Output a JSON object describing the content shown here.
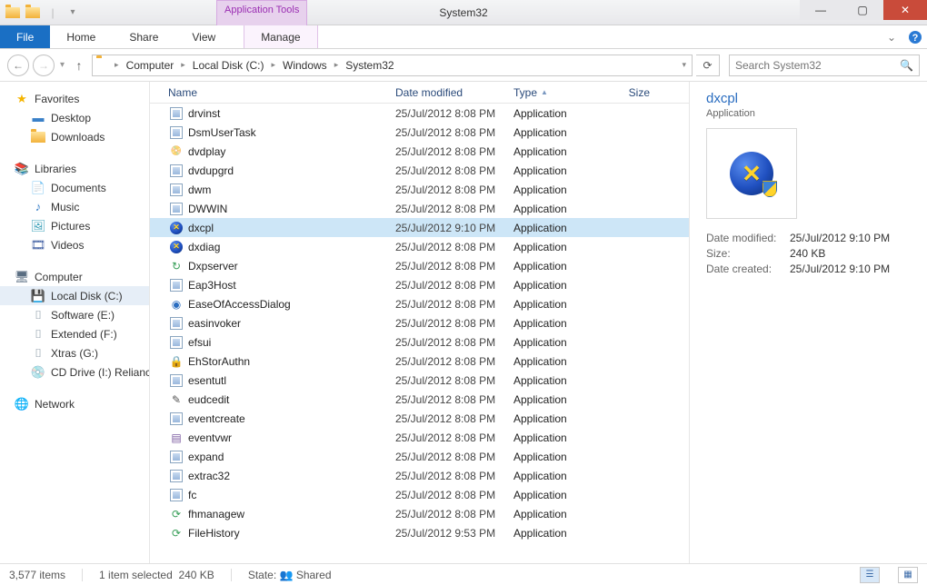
{
  "window": {
    "title": "System32",
    "context_tab": "Application Tools"
  },
  "ribbon": {
    "file": "File",
    "tabs": [
      "Home",
      "Share",
      "View"
    ],
    "context": "Manage"
  },
  "breadcrumb": [
    "Computer",
    "Local Disk (C:)",
    "Windows",
    "System32"
  ],
  "search_placeholder": "Search System32",
  "tree": {
    "favorites": {
      "label": "Favorites",
      "items": [
        "Desktop",
        "Downloads"
      ]
    },
    "libraries": {
      "label": "Libraries",
      "items": [
        "Documents",
        "Music",
        "Pictures",
        "Videos"
      ]
    },
    "computer": {
      "label": "Computer",
      "items": [
        "Local Disk (C:)",
        "Software (E:)",
        "Extended (F:)",
        "Xtras (G:)",
        "CD Drive (I:) Reliance"
      ]
    },
    "network": {
      "label": "Network"
    }
  },
  "columns": {
    "name": "Name",
    "date": "Date modified",
    "type": "Type",
    "size": "Size"
  },
  "files": [
    {
      "name": "drvinst",
      "date": "25/Jul/2012 8:08 PM",
      "type": "Application",
      "icon": "exe"
    },
    {
      "name": "DsmUserTask",
      "date": "25/Jul/2012 8:08 PM",
      "type": "Application",
      "icon": "exe"
    },
    {
      "name": "dvdplay",
      "date": "25/Jul/2012 8:08 PM",
      "type": "Application",
      "icon": "dvd"
    },
    {
      "name": "dvdupgrd",
      "date": "25/Jul/2012 8:08 PM",
      "type": "Application",
      "icon": "exe"
    },
    {
      "name": "dwm",
      "date": "25/Jul/2012 8:08 PM",
      "type": "Application",
      "icon": "exe"
    },
    {
      "name": "DWWIN",
      "date": "25/Jul/2012 8:08 PM",
      "type": "Application",
      "icon": "exe"
    },
    {
      "name": "dxcpl",
      "date": "25/Jul/2012 9:10 PM",
      "type": "Application",
      "icon": "dx",
      "selected": true
    },
    {
      "name": "dxdiag",
      "date": "25/Jul/2012 8:08 PM",
      "type": "Application",
      "icon": "dx"
    },
    {
      "name": "Dxpserver",
      "date": "25/Jul/2012 8:08 PM",
      "type": "Application",
      "icon": "grn"
    },
    {
      "name": "Eap3Host",
      "date": "25/Jul/2012 8:08 PM",
      "type": "Application",
      "icon": "exe"
    },
    {
      "name": "EaseOfAccessDialog",
      "date": "25/Jul/2012 8:08 PM",
      "type": "Application",
      "icon": "eoa"
    },
    {
      "name": "easinvoker",
      "date": "25/Jul/2012 8:08 PM",
      "type": "Application",
      "icon": "exe"
    },
    {
      "name": "efsui",
      "date": "25/Jul/2012 8:08 PM",
      "type": "Application",
      "icon": "exe"
    },
    {
      "name": "EhStorAuthn",
      "date": "25/Jul/2012 8:08 PM",
      "type": "Application",
      "icon": "lock"
    },
    {
      "name": "esentutl",
      "date": "25/Jul/2012 8:08 PM",
      "type": "Application",
      "icon": "exe"
    },
    {
      "name": "eudcedit",
      "date": "25/Jul/2012 8:08 PM",
      "type": "Application",
      "icon": "edit"
    },
    {
      "name": "eventcreate",
      "date": "25/Jul/2012 8:08 PM",
      "type": "Application",
      "icon": "exe"
    },
    {
      "name": "eventvwr",
      "date": "25/Jul/2012 8:08 PM",
      "type": "Application",
      "icon": "evt"
    },
    {
      "name": "expand",
      "date": "25/Jul/2012 8:08 PM",
      "type": "Application",
      "icon": "exe"
    },
    {
      "name": "extrac32",
      "date": "25/Jul/2012 8:08 PM",
      "type": "Application",
      "icon": "exe"
    },
    {
      "name": "fc",
      "date": "25/Jul/2012 8:08 PM",
      "type": "Application",
      "icon": "exe"
    },
    {
      "name": "fhmanagew",
      "date": "25/Jul/2012 8:08 PM",
      "type": "Application",
      "icon": "fh"
    },
    {
      "name": "FileHistory",
      "date": "25/Jul/2012 9:53 PM",
      "type": "Application",
      "icon": "fh"
    }
  ],
  "details": {
    "name": "dxcpl",
    "type": "Application",
    "rows": [
      {
        "label": "Date modified:",
        "value": "25/Jul/2012 9:10 PM"
      },
      {
        "label": "Size:",
        "value": "240 KB"
      },
      {
        "label": "Date created:",
        "value": "25/Jul/2012 9:10 PM"
      }
    ]
  },
  "status": {
    "items": "3,577 items",
    "selected": "1 item selected",
    "size": "240 KB",
    "state_label": "State:",
    "state_value": "Shared"
  }
}
